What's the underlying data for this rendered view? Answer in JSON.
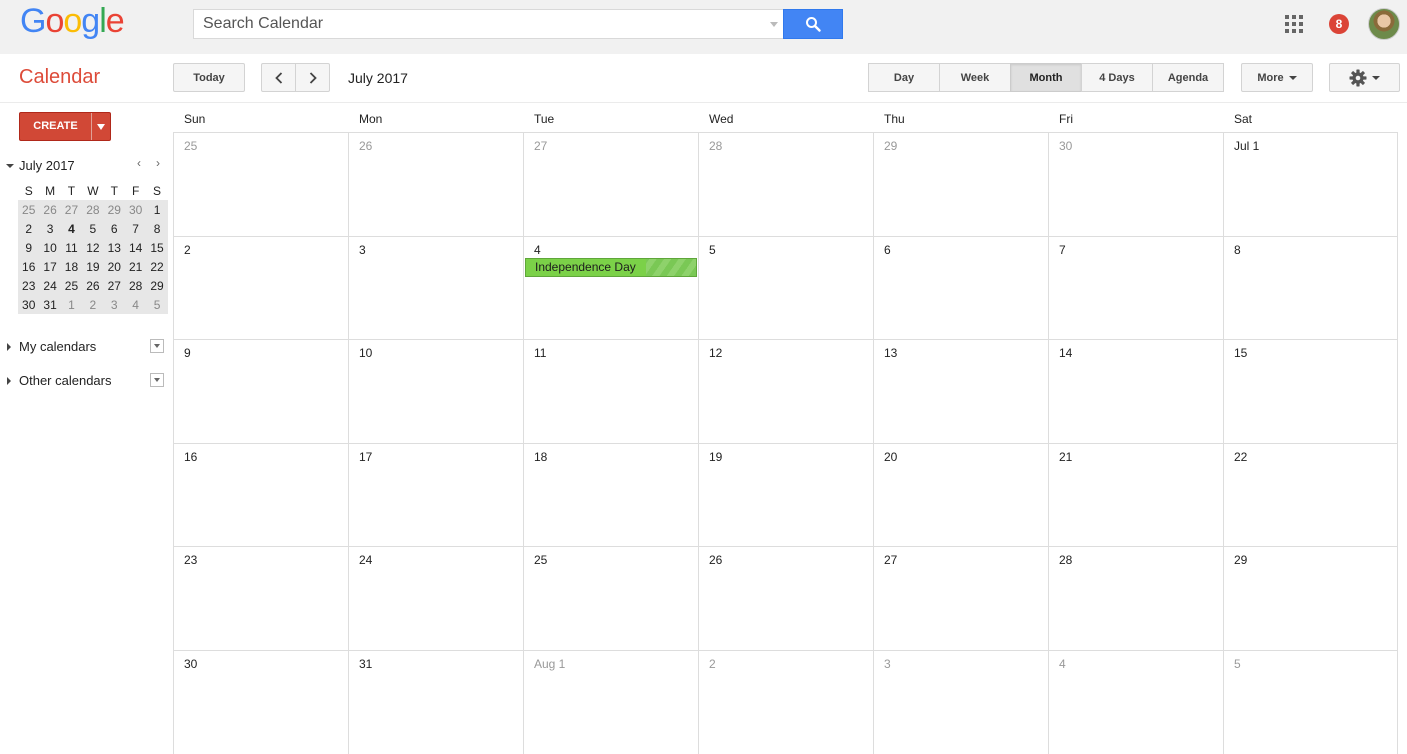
{
  "logo": {
    "text": "Google"
  },
  "search": {
    "placeholder": "Search Calendar"
  },
  "notifications": {
    "count": "8"
  },
  "app": {
    "title": "Calendar"
  },
  "toolbar": {
    "today_label": "Today",
    "date_range": "July 2017",
    "views": [
      "Day",
      "Week",
      "Month",
      "4 Days",
      "Agenda"
    ],
    "active_view": "Month",
    "more_label": "More"
  },
  "sidebar": {
    "create_label": "CREATE",
    "mini_calendar": {
      "title": "July 2017",
      "weekdays": [
        "S",
        "M",
        "T",
        "W",
        "T",
        "F",
        "S"
      ],
      "weeks": [
        [
          "25",
          "26",
          "27",
          "28",
          "29",
          "30",
          "1"
        ],
        [
          "2",
          "3",
          "4",
          "5",
          "6",
          "7",
          "8"
        ],
        [
          "9",
          "10",
          "11",
          "12",
          "13",
          "14",
          "15"
        ],
        [
          "16",
          "17",
          "18",
          "19",
          "20",
          "21",
          "22"
        ],
        [
          "23",
          "24",
          "25",
          "26",
          "27",
          "28",
          "29"
        ],
        [
          "30",
          "31",
          "1",
          "2",
          "3",
          "4",
          "5"
        ]
      ],
      "today": "4"
    },
    "sections": [
      "My calendars",
      "Other calendars"
    ]
  },
  "month": {
    "weekday_headers": [
      "Sun",
      "Mon",
      "Tue",
      "Wed",
      "Thu",
      "Fri",
      "Sat"
    ],
    "weeks": [
      [
        "25",
        "26",
        "27",
        "28",
        "29",
        "30",
        "Jul 1"
      ],
      [
        "2",
        "3",
        "4",
        "5",
        "6",
        "7",
        "8"
      ],
      [
        "9",
        "10",
        "11",
        "12",
        "13",
        "14",
        "15"
      ],
      [
        "16",
        "17",
        "18",
        "19",
        "20",
        "21",
        "22"
      ],
      [
        "23",
        "24",
        "25",
        "26",
        "27",
        "28",
        "29"
      ],
      [
        "30",
        "31",
        "Aug 1",
        "2",
        "3",
        "4",
        "5"
      ]
    ],
    "events": [
      {
        "title": "Independence Day",
        "date": "4",
        "color": "#7bd148"
      }
    ]
  },
  "icons": {
    "search": "search-icon",
    "apps": "apps-grid-icon",
    "prev": "chevron-left-icon",
    "next": "chevron-right-icon",
    "settings": "gear-icon"
  }
}
